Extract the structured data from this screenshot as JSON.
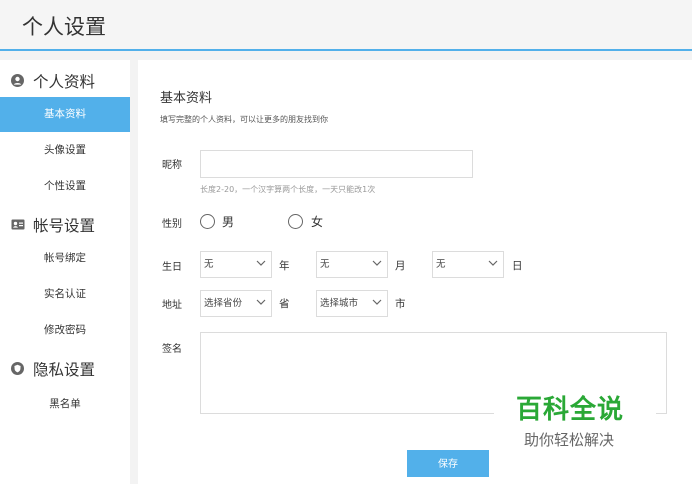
{
  "header": {
    "title": "个人设置"
  },
  "sidebar": {
    "sections": [
      {
        "label": "个人资料",
        "icon": "user-circle-icon",
        "items": [
          {
            "label": "基本资料",
            "active": true
          },
          {
            "label": "头像设置"
          },
          {
            "label": "个性设置"
          }
        ]
      },
      {
        "label": "帐号设置",
        "icon": "id-card-icon",
        "items": [
          {
            "label": "帐号绑定"
          },
          {
            "label": "实名认证"
          },
          {
            "label": "修改密码"
          }
        ]
      },
      {
        "label": "隐私设置",
        "icon": "shield-icon",
        "items": [
          {
            "label": "黑名单"
          }
        ]
      }
    ]
  },
  "main": {
    "title": "基本资料",
    "subtitle": "填写完整的个人资料，可以让更多的朋友找到你",
    "nickname": {
      "label": "昵称",
      "value": "",
      "hint": "长度2-20，一个汉字算两个长度，一天只能改1次"
    },
    "gender": {
      "label": "性别",
      "options": [
        "男",
        "女"
      ]
    },
    "birthday": {
      "label": "生日",
      "year": {
        "value": "无",
        "unit": "年"
      },
      "month": {
        "value": "无",
        "unit": "月"
      },
      "day": {
        "value": "无",
        "unit": "日"
      }
    },
    "address": {
      "label": "地址",
      "province": {
        "value": "选择省份",
        "unit": "省"
      },
      "city": {
        "value": "选择城市",
        "unit": "市"
      }
    },
    "signature": {
      "label": "签名",
      "value": ""
    },
    "save_label": "保存"
  },
  "watermark": {
    "main": "百科全说",
    "sub": "助你轻松解决"
  },
  "colors": {
    "accent": "#52b0ea",
    "watermark_green": "#2aa836"
  }
}
